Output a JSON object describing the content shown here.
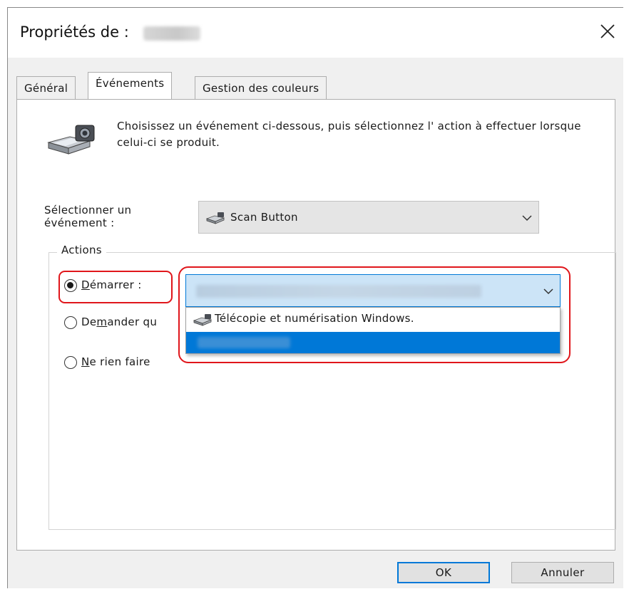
{
  "window": {
    "title_prefix": "Propriétés de :",
    "close_icon": "close-icon"
  },
  "tabs": [
    {
      "label": "Général",
      "active": false
    },
    {
      "label": "Événements",
      "active": true
    },
    {
      "label": "Gestion des couleurs",
      "active": false
    }
  ],
  "intro": {
    "icon": "scanner-camera-icon",
    "text": "Choisissez un événement ci-dessous, puis sélectionnez l' action à effectuer lorsque celui-ci se produit."
  },
  "event_select": {
    "label_line1": "Sélectionner un",
    "label_line2": "événement :",
    "selected_value": "Scan Button",
    "icon": "scanner-icon"
  },
  "actions": {
    "group_label": "Actions",
    "options": [
      {
        "label_pre": "",
        "label_ul": "D",
        "label_post": "émarrer :",
        "checked": true
      },
      {
        "label_pre": "De",
        "label_ul": "m",
        "label_post": "ander qu",
        "checked": false
      },
      {
        "label_pre": "",
        "label_ul": "N",
        "label_post": "e rien faire",
        "checked": false
      }
    ],
    "app_dropdown": {
      "open": true,
      "items": [
        {
          "label": "Télécopie et numérisation Windows.",
          "icon": "scanner-icon",
          "selected": false
        },
        {
          "label": "",
          "selected": true
        }
      ]
    }
  },
  "buttons": {
    "ok": "OK",
    "cancel": "Annuler"
  },
  "colors": {
    "highlight": "#e0161b",
    "selection": "#0078d7",
    "combo_bg": "#e5e5e5"
  }
}
